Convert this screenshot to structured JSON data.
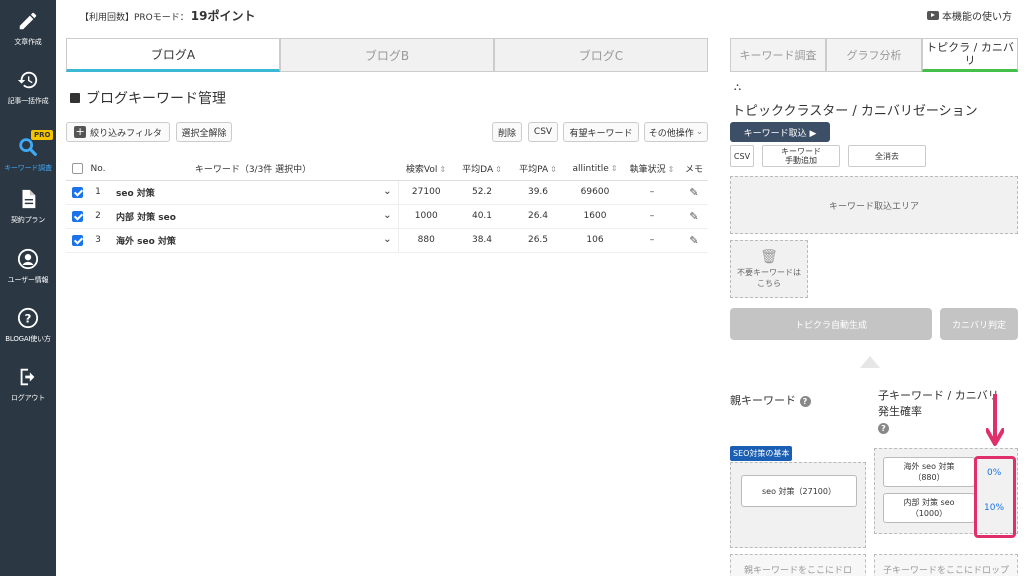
{
  "sidebar": {
    "items": [
      {
        "label": "文章作成",
        "icon": "pencil-icon"
      },
      {
        "label": "記事一括作成",
        "icon": "history-icon"
      },
      {
        "label": "キーワード調査",
        "icon": "search-icon",
        "badge": "PRO"
      },
      {
        "label": "契約プラン",
        "icon": "document-icon"
      },
      {
        "label": "ユーザー情報",
        "icon": "user-icon"
      },
      {
        "label": "BLOGAI使い方",
        "icon": "help-icon"
      },
      {
        "label": "ログアウト",
        "icon": "logout-icon"
      }
    ]
  },
  "header": {
    "usage_prefix": "【利用回数】PROモード：",
    "usage_value": "19ポイント",
    "howto_label": "本機能の使い方"
  },
  "blog_tabs": [
    "ブログA",
    "ブログB",
    "ブログC"
  ],
  "main": {
    "title": "ブログキーワード管理",
    "toolbar": {
      "filter": "絞り込みフィルタ",
      "deselect": "選択全解除",
      "delete": "削除",
      "csv": "CSV",
      "favorite": "有望キーワード",
      "other": "その他操作"
    },
    "table": {
      "headers": {
        "no": "No.",
        "keyword": "キーワード（3/3件 選択中）",
        "vol": "検索Vol",
        "da": "平均DA",
        "pa": "平均PA",
        "allintitle": "allintitle",
        "status": "執筆状況",
        "memo": "メモ"
      },
      "rows": [
        {
          "no": "1",
          "keyword": "seo 対策",
          "vol": "27100",
          "da": "52.2",
          "pa": "39.6",
          "allintitle": "69600",
          "status": "–"
        },
        {
          "no": "2",
          "keyword": "内部 対策 seo",
          "vol": "1000",
          "da": "40.1",
          "pa": "26.4",
          "allintitle": "1600",
          "status": "–"
        },
        {
          "no": "3",
          "keyword": "海外 seo 対策",
          "vol": "880",
          "da": "38.4",
          "pa": "26.5",
          "allintitle": "106",
          "status": "–"
        }
      ]
    }
  },
  "right": {
    "tabs": [
      "キーワード調査",
      "グラフ分析",
      "トピクラ / カニバリ"
    ],
    "title": "トピッククラスター / カニバリゼーション",
    "import_btn": "キーワード取込 ▶",
    "csv": "CSV",
    "manual_add": "キーワード\n手動追加",
    "clear_all": "全消去",
    "import_area": "キーワード取込エリア",
    "trash_area": "不要キーワードは\nこちら",
    "auto_gen": "トピクラ自動生成",
    "cannibal_judge": "カニバリ判定",
    "parent_label": "親キーワード",
    "child_label_1": "子キーワード / カニバリ",
    "child_label_2": "発生確率",
    "seo_tag": "SEO対策の基本",
    "parent_kw": "seo 対策（27100）",
    "children": [
      {
        "kw": "海外 seo 対策\n（880）",
        "pct": "0%"
      },
      {
        "kw": "内部 対策 seo\n（1000）",
        "pct": "10%"
      }
    ],
    "drop_parent": "親キーワードをここにドロ",
    "drop_child": "子キーワードをここにドロップ"
  },
  "colors": {
    "sidebar_bg": "#2b3743",
    "active_nav": "#3fa9f5",
    "tab_underline_blue": "#3bb8d3",
    "tab_underline_green": "#44c04a",
    "highlight": "#e0306c"
  }
}
